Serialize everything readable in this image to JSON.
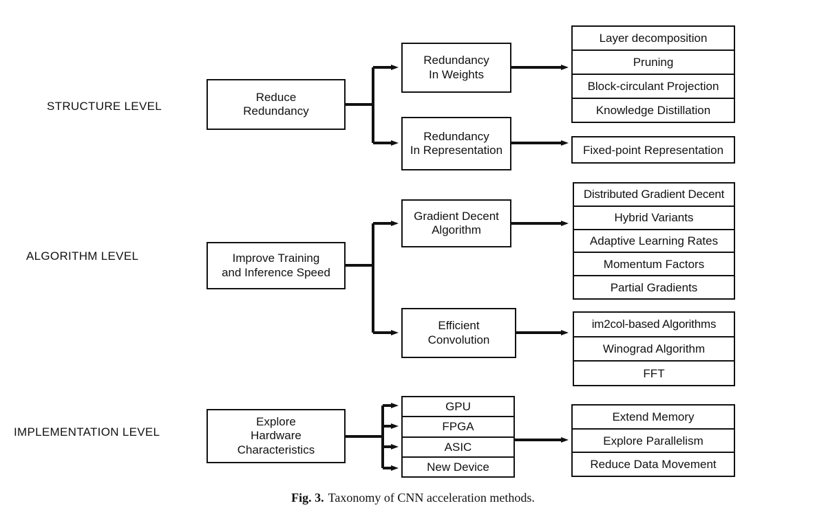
{
  "figure": {
    "caption_label": "Fig. 3.",
    "caption_text": "Taxonomy of CNN acceleration methods.",
    "line_color": "#111111",
    "background_color": "#ffffff"
  },
  "levels": [
    {
      "label": "STRUCTURE LEVEL",
      "root": "Reduce\nRedundancy",
      "branches": [
        {
          "title": "Redundancy\nIn Weights",
          "leaves": [
            "Layer decomposition",
            "Pruning",
            "Block-circulant Projection",
            "Knowledge Distillation"
          ]
        },
        {
          "title": "Redundancy\nIn Representation",
          "leaves": [
            "Fixed-point Representation"
          ]
        }
      ]
    },
    {
      "label": "ALGORITHM LEVEL",
      "root": "Improve Training\nand Inference Speed",
      "branches": [
        {
          "title": "Gradient Decent\nAlgorithm",
          "leaves": [
            "Distributed Gradient Decent",
            "Hybrid Variants",
            "Adaptive Learning Rates",
            "Momentum Factors",
            "Partial Gradients"
          ]
        },
        {
          "title": "Efficient\nConvolution",
          "leaves": [
            "im2col-based Algorithms",
            "Winograd Algorithm",
            "FFT"
          ]
        }
      ]
    },
    {
      "label": "IMPLEMENTATION LEVEL",
      "root": "Explore\nHardware\nCharacteristics",
      "hardware": [
        "GPU",
        "FPGA",
        "ASIC",
        "New Device"
      ],
      "outcomes": [
        "Extend Memory",
        "Explore Parallelism",
        "Reduce Data Movement"
      ]
    }
  ]
}
